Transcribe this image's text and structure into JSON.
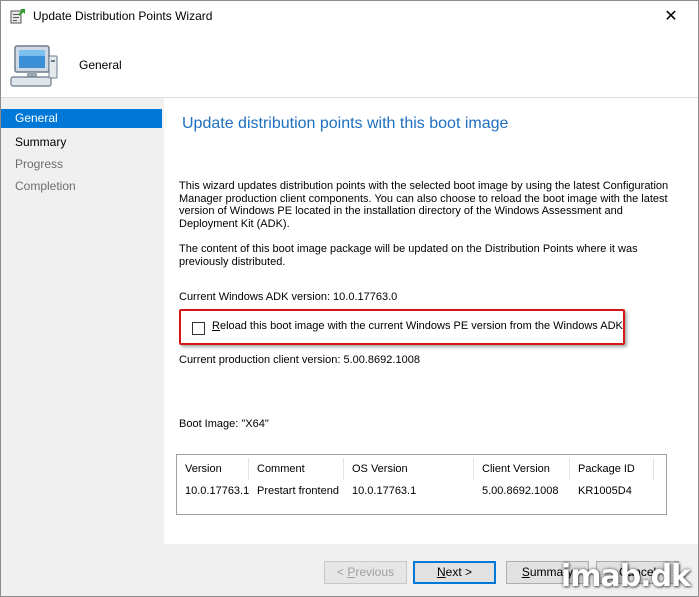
{
  "window": {
    "title": "Update Distribution Points Wizard",
    "close_glyph": "✕"
  },
  "header": {
    "title": "General",
    "icon": "computer-monitor-icon"
  },
  "sidebar": {
    "items": [
      {
        "label": "General",
        "state": "active"
      },
      {
        "label": "Summary",
        "state": "enabled"
      },
      {
        "label": "Progress",
        "state": "disabled"
      },
      {
        "label": "Completion",
        "state": "disabled"
      }
    ]
  },
  "main": {
    "title": "Update distribution points with this boot image",
    "paragraph1": "This wizard updates distribution points with the selected boot image by using the latest Configuration Manager production client components. You can also choose to reload the boot image with the latest version of Windows PE located in the installation directory of the Windows Assessment and Deployment Kit (ADK).",
    "paragraph2": "The content of this boot image package will be updated on the Distribution Points where it was previously distributed.",
    "adk_version": "Current Windows ADK version: 10.0.17763.0",
    "reload_checkbox": {
      "label_underlined": "R",
      "label_rest": "eload this boot image with the current Windows PE version from the Windows ADK",
      "checked": false
    },
    "client_version": "Current production client version: 5.00.8692.1008",
    "boot_image": "Boot Image: \"X64\""
  },
  "table": {
    "columns": [
      "Version",
      "Comment",
      "OS Version",
      "Client Version",
      "Package ID"
    ],
    "rows": [
      [
        "10.0.17763.1",
        "Prestart frontend",
        "10.0.17763.1",
        "5.00.8692.1008",
        "KR1005D4"
      ]
    ]
  },
  "buttons": {
    "previous": {
      "prefix": "< ",
      "underlined": "P",
      "rest": "revious",
      "enabled": false
    },
    "next": {
      "underlined": "N",
      "rest": "ext >",
      "enabled": true
    },
    "summary": {
      "underlined": "S",
      "rest": "ummary",
      "enabled": true
    },
    "cancel": {
      "label": "Cancel",
      "enabled": true
    }
  },
  "watermark": "imab.dk",
  "colors": {
    "accent": "#0078d7",
    "title_blue": "#1e6fbf",
    "highlight_red": "#d4161b"
  }
}
